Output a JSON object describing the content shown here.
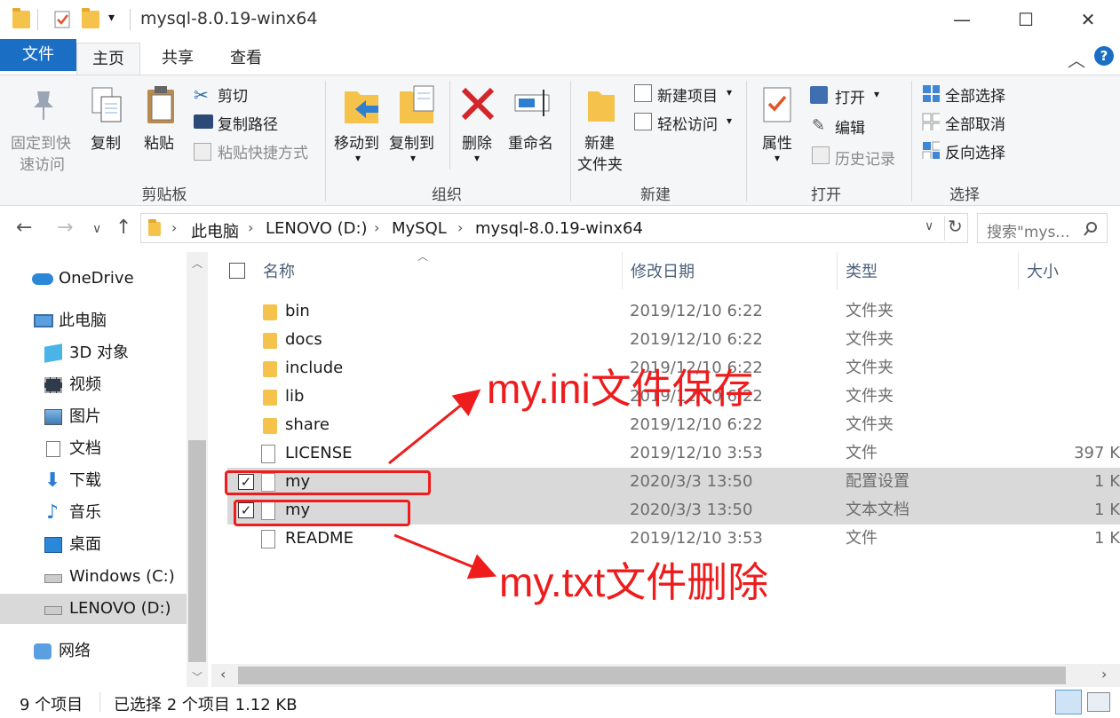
{
  "window": {
    "title": "mysql-8.0.19-winx64",
    "minimize": "—",
    "maximize": "☐",
    "close": "✕"
  },
  "tabs": {
    "file": "文件",
    "home": "主页",
    "share": "共享",
    "view": "查看"
  },
  "ribbon": {
    "pin_line1": "固定到快",
    "pin_line2": "速访问",
    "copy": "复制",
    "paste": "粘贴",
    "cut": "剪切",
    "copy_path": "复制路径",
    "paste_shortcut": "粘贴快捷方式",
    "group_clipboard": "剪贴板",
    "move_to": "移动到",
    "copy_to": "复制到",
    "delete": "删除",
    "rename": "重命名",
    "group_organize": "组织",
    "new_folder_line1": "新建",
    "new_folder_line2": "文件夹",
    "new_item": "新建项目",
    "easy_access": "轻松访问",
    "group_new": "新建",
    "properties": "属性",
    "open": "打开",
    "edit": "编辑",
    "history": "历史记录",
    "group_open": "打开",
    "select_all": "全部选择",
    "select_none": "全部取消",
    "invert_selection": "反向选择",
    "group_select": "选择"
  },
  "address": {
    "crumbs": [
      "此电脑",
      "LENOVO (D:)",
      "MySQL",
      "mysql-8.0.19-winx64"
    ],
    "search_placeholder": "搜索\"mys..."
  },
  "nav": {
    "items": [
      {
        "label": "OneDrive"
      },
      {
        "label": "此电脑"
      },
      {
        "label": "3D 对象"
      },
      {
        "label": "视频"
      },
      {
        "label": "图片"
      },
      {
        "label": "文档"
      },
      {
        "label": "下载"
      },
      {
        "label": "音乐"
      },
      {
        "label": "桌面"
      },
      {
        "label": "Windows (C:)"
      },
      {
        "label": "LENOVO (D:)"
      },
      {
        "label": "网络"
      }
    ]
  },
  "columns": {
    "name": "名称",
    "date": "修改日期",
    "type": "类型",
    "size": "大小"
  },
  "files": [
    {
      "name": "bin",
      "date": "2019/12/10 6:22",
      "type": "文件夹",
      "size": ""
    },
    {
      "name": "docs",
      "date": "2019/12/10 6:22",
      "type": "文件夹",
      "size": ""
    },
    {
      "name": "include",
      "date": "2019/12/10 6:22",
      "type": "文件夹",
      "size": ""
    },
    {
      "name": "lib",
      "date": "2019/12/10 6:22",
      "type": "文件夹",
      "size": ""
    },
    {
      "name": "share",
      "date": "2019/12/10 6:22",
      "type": "文件夹",
      "size": ""
    },
    {
      "name": "LICENSE",
      "date": "2019/12/10 3:53",
      "type": "文件",
      "size": "397 K"
    },
    {
      "name": "my",
      "date": "2020/3/3 13:50",
      "type": "配置设置",
      "size": "1 K"
    },
    {
      "name": "my",
      "date": "2020/3/3 13:50",
      "type": "文本文档",
      "size": "1 K"
    },
    {
      "name": "README",
      "date": "2019/12/10 3:53",
      "type": "文件",
      "size": "1 K"
    }
  ],
  "status": {
    "count": "9 个项目",
    "selection": "已选择 2 个项目 1.12 KB"
  },
  "annotations": {
    "keep": "my.ini文件保存",
    "delete": "my.txt文件删除"
  },
  "colors": {
    "accent": "#1a6fc4",
    "annotation": "#ee1c1c",
    "selection": "#d9d9d9"
  }
}
